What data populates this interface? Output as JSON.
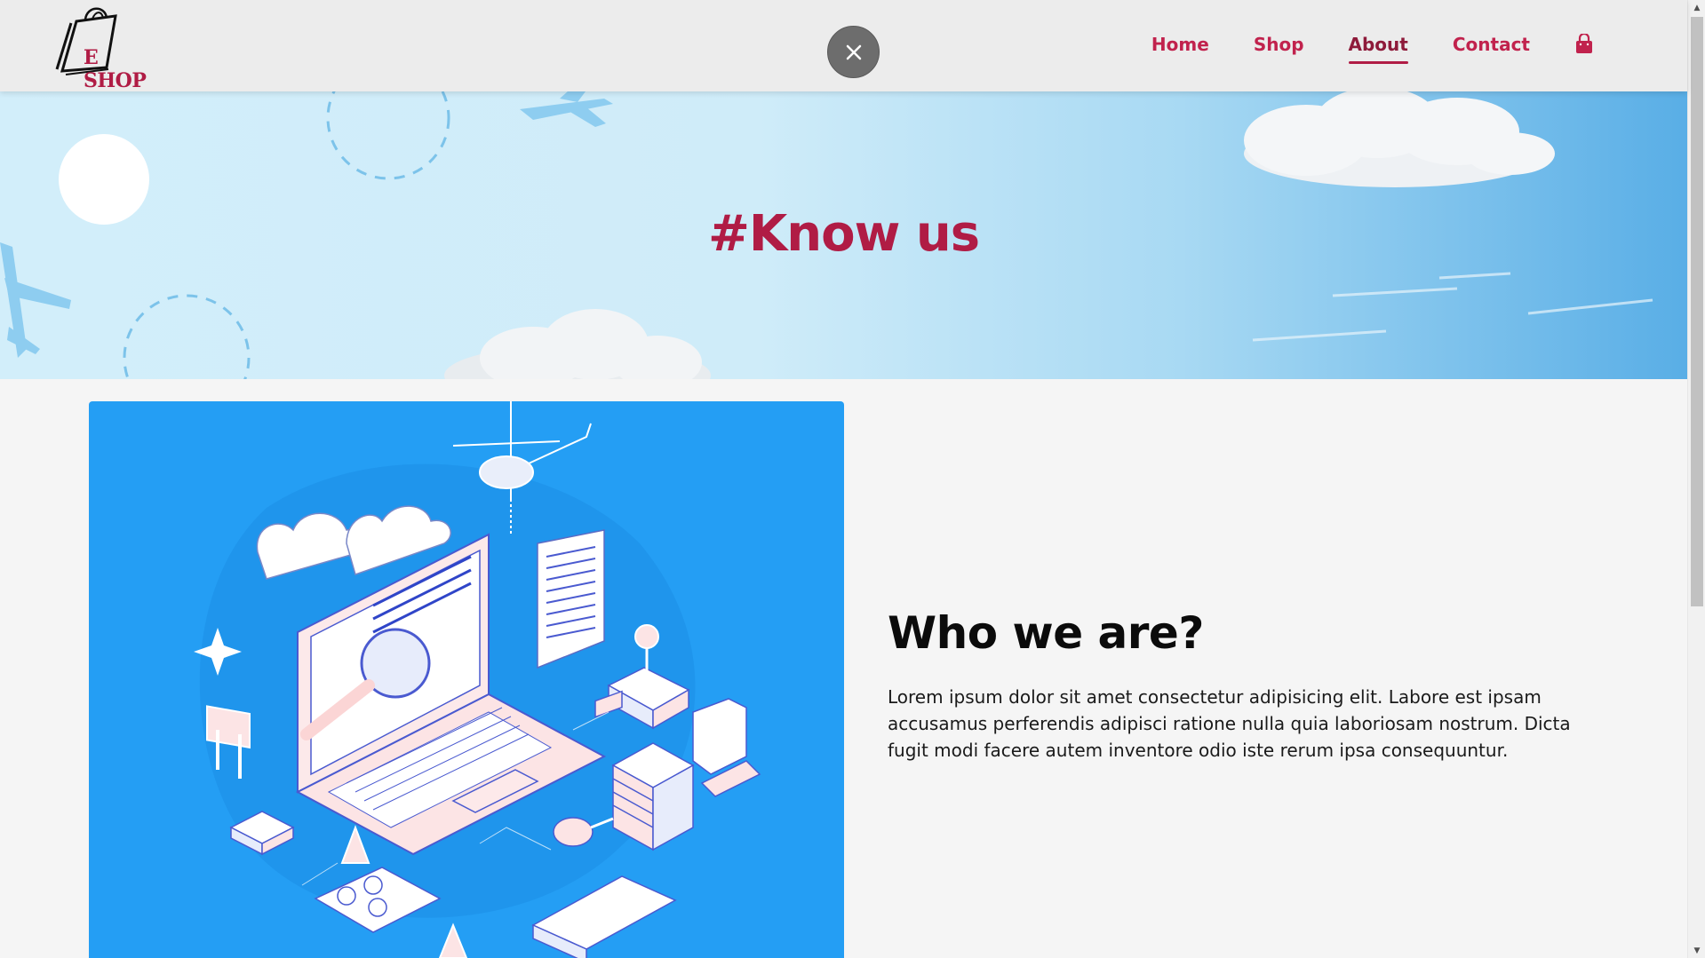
{
  "header": {
    "logo_text": "E SHOP",
    "nav": [
      {
        "label": "Home",
        "active": false
      },
      {
        "label": "Shop",
        "active": false
      },
      {
        "label": "About",
        "active": true
      },
      {
        "label": "Contact",
        "active": false
      }
    ],
    "icons": {
      "close": "close-icon",
      "cart": "shopping-bag-icon"
    }
  },
  "banner": {
    "title": "#Know us"
  },
  "about": {
    "heading": "Who we are?",
    "body": "Lorem ipsum dolor sit amet consectetur adipisicing elit. Labore est ipsam accusamus perferendis adipisci ratione nulla quia laboriosam nostrum. Dicta fugit modi facere autem inventore odio iste rerum ipsa consequuntur."
  },
  "colors": {
    "accent": "#b01c45",
    "nav_link": "#c1224d",
    "illustration_bg": "#249ef4",
    "header_bg": "#ececec"
  }
}
